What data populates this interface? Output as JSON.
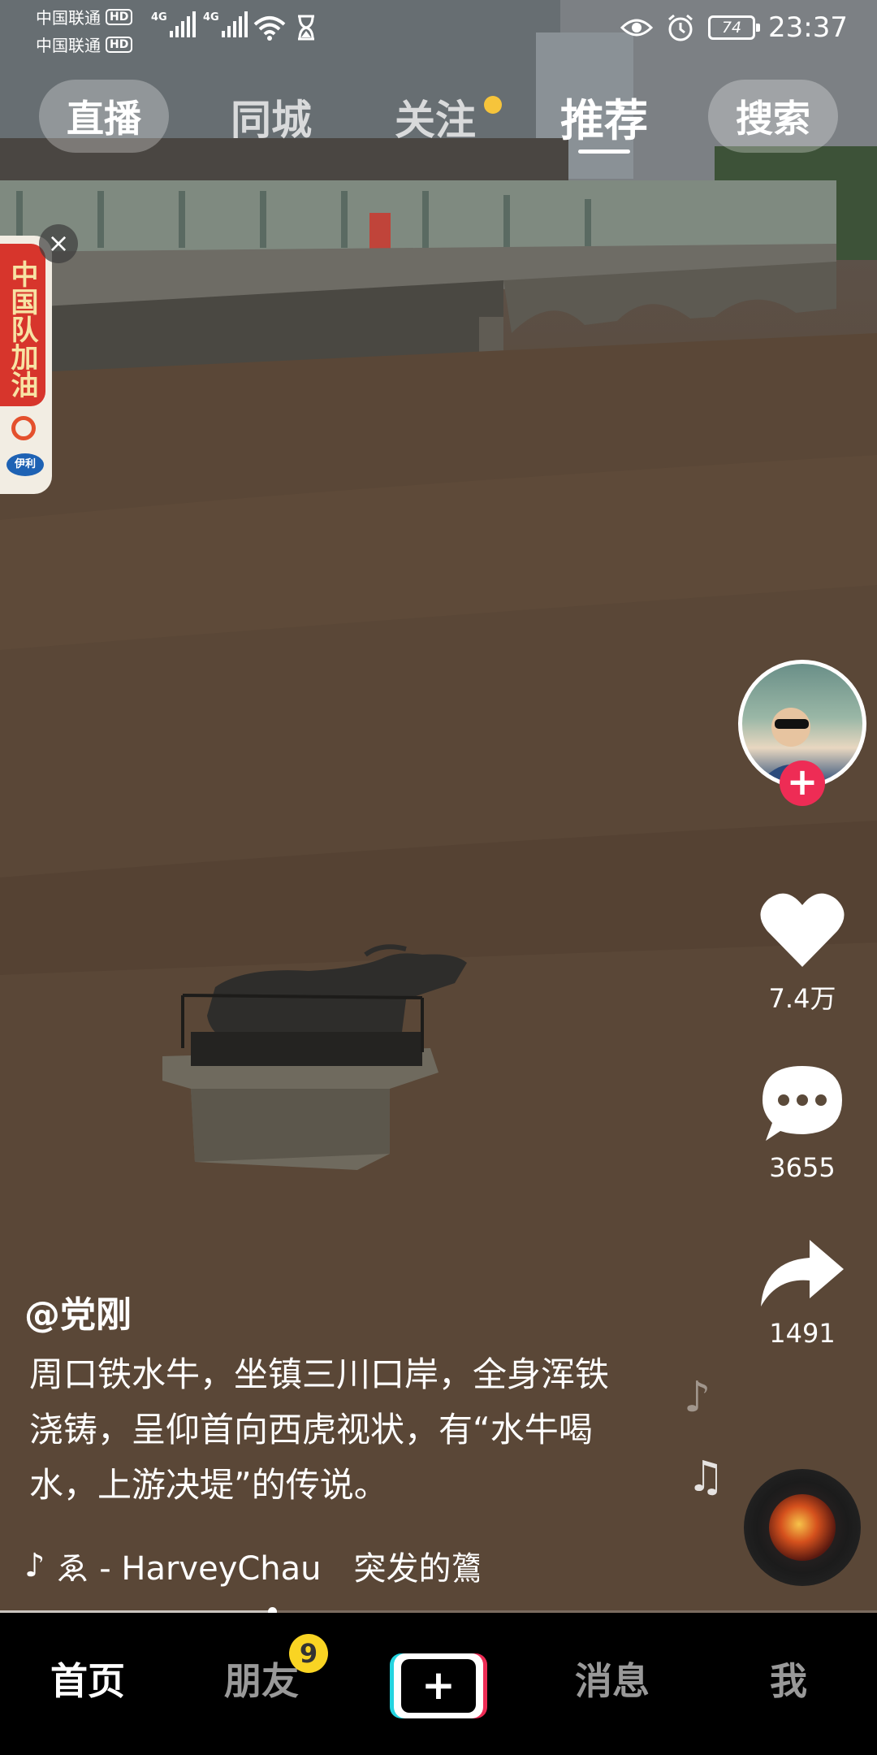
{
  "status_bar": {
    "carrier1": "中国联通",
    "carrier2": "中国联通",
    "hd": "HD",
    "network": "4G",
    "battery": "74",
    "time": "23:37"
  },
  "top_tabs": {
    "live": "直播",
    "local": "同城",
    "following": "关注",
    "recommend": "推荐",
    "search": "搜索"
  },
  "ad": {
    "text": "中国队加油",
    "brand": "伊利"
  },
  "right_rail": {
    "likes": "7.4万",
    "comments": "3655",
    "shares": "1491"
  },
  "video": {
    "author": "@党刚",
    "caption": "周口铁水牛，坐镇三川口岸，全身浑铁浇铸，呈仰首向西虎视状，有“水牛喝水，上游决堤”的传说。",
    "music": "ゑ - HarveyChau　突发的鷟"
  },
  "progress_fraction": 0.31,
  "bottom_nav": {
    "home": "首页",
    "friends": "朋友",
    "friends_badge": "9",
    "create": "+",
    "messages": "消息",
    "me": "我"
  },
  "colors": {
    "like_red": "#ee2c55",
    "badge_yellow": "#f9d423",
    "create_cyan": "#24d4e0",
    "follow_dot": "#f6c43b"
  }
}
